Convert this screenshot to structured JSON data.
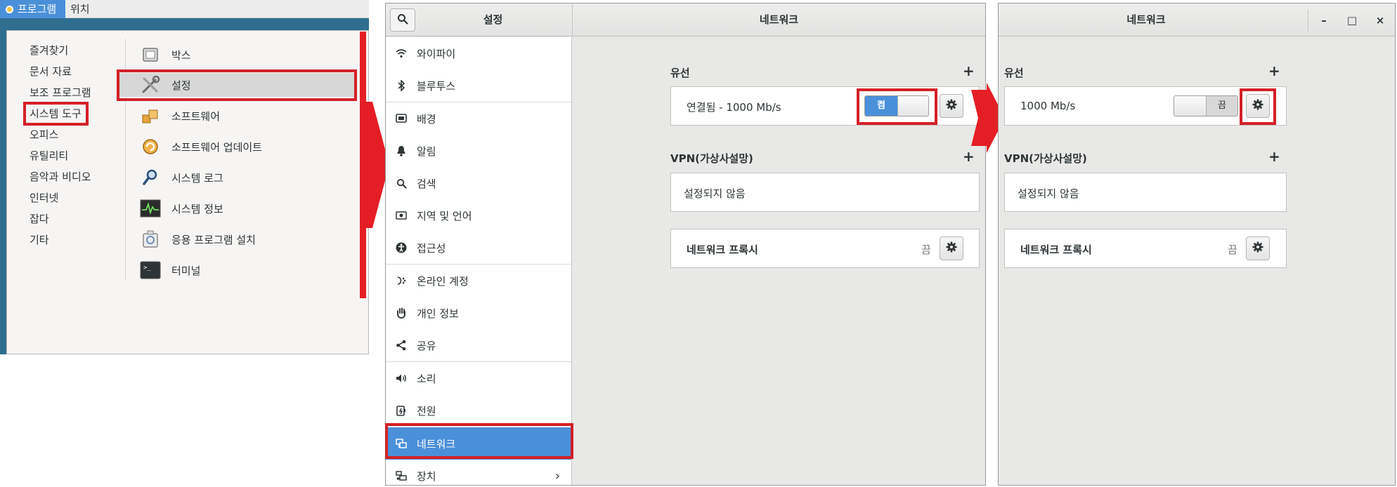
{
  "menu": {
    "apps_button": "프로그램",
    "places_button": "위치",
    "categories": [
      "즐겨찾기",
      "문서 자료",
      "보조 프로그램",
      "시스템 도구",
      "오피스",
      "유틸리티",
      "음악과 비디오",
      "인터넷",
      "잡다",
      "기타"
    ],
    "apps": [
      "박스",
      "설정",
      "소프트웨어",
      "소프트웨어 업데이트",
      "시스템 로그",
      "시스템 정보",
      "응용 프로그램 설치",
      "터미널"
    ]
  },
  "settings": {
    "sidebar_title": "설정",
    "main_title": "네트워크",
    "sidebar_items": [
      "와이파이",
      "블루투스",
      "배경",
      "알림",
      "검색",
      "지역 및 언어",
      "접근성",
      "온라인 계정",
      "개인 정보",
      "공유",
      "소리",
      "전원",
      "네트워크",
      "장치"
    ],
    "wired_title": "유선",
    "wired_status": "연결됨 - 1000 Mb/s",
    "switch_on_label": "켬",
    "vpn_title": "VPN(가상사설망)",
    "vpn_status": "설정되지 않음",
    "proxy_title": "네트워크 프록시",
    "proxy_status": "끔"
  },
  "network_window": {
    "title": "네트워크",
    "wired_title": "유선",
    "wired_status": "1000 Mb/s",
    "switch_off_label": "끔",
    "vpn_title": "VPN(가상사설망)",
    "vpn_status": "설정되지 않음",
    "proxy_title": "네트워크 프록시",
    "proxy_status": "끔",
    "minimize": "–",
    "maximize": "□",
    "close": "×"
  },
  "colors": {
    "highlight": "#d42027",
    "accent": "#4a90d9"
  }
}
